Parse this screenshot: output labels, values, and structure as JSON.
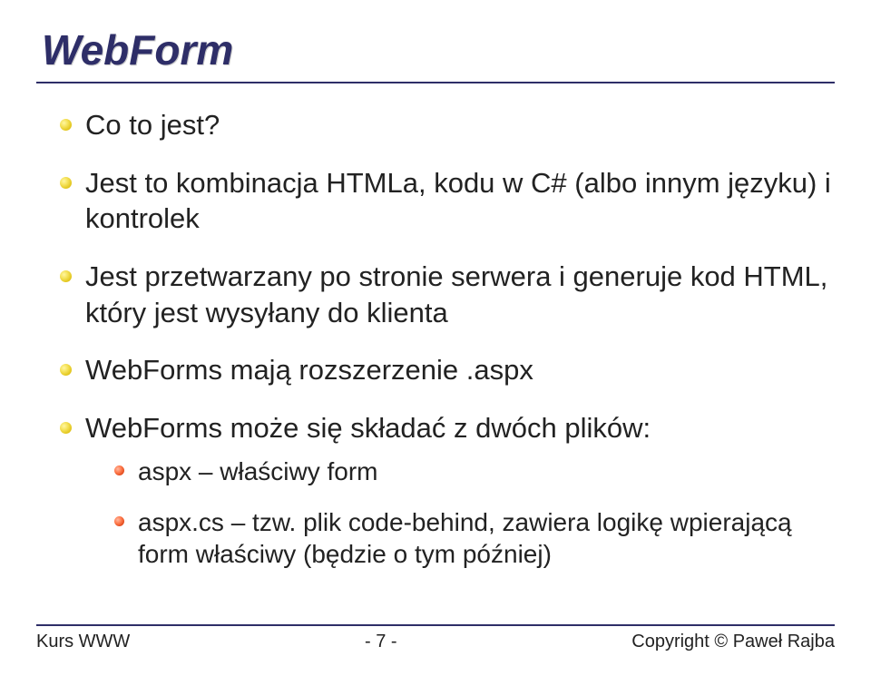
{
  "title": "WebForm",
  "bullets": {
    "b1": "Co to jest?",
    "b2": "Jest to kombinacja HTMLa, kodu w C# (albo innym języku) i kontrolek",
    "b3": "Jest przetwarzany po stronie serwera i generuje kod HTML, który jest wysyłany do klienta",
    "b4": "WebForms mają rozszerzenie .aspx",
    "b5": "WebForms może się składać z dwóch plików:",
    "b5s1": "aspx – właściwy form",
    "b5s2": "aspx.cs – tzw. plik code-behind, zawiera logikę wpierającą form właściwy (będzie o tym później)"
  },
  "footer": {
    "left": "Kurs WWW",
    "center": "- 7 -",
    "right": "Copyright © Paweł Rajba"
  }
}
